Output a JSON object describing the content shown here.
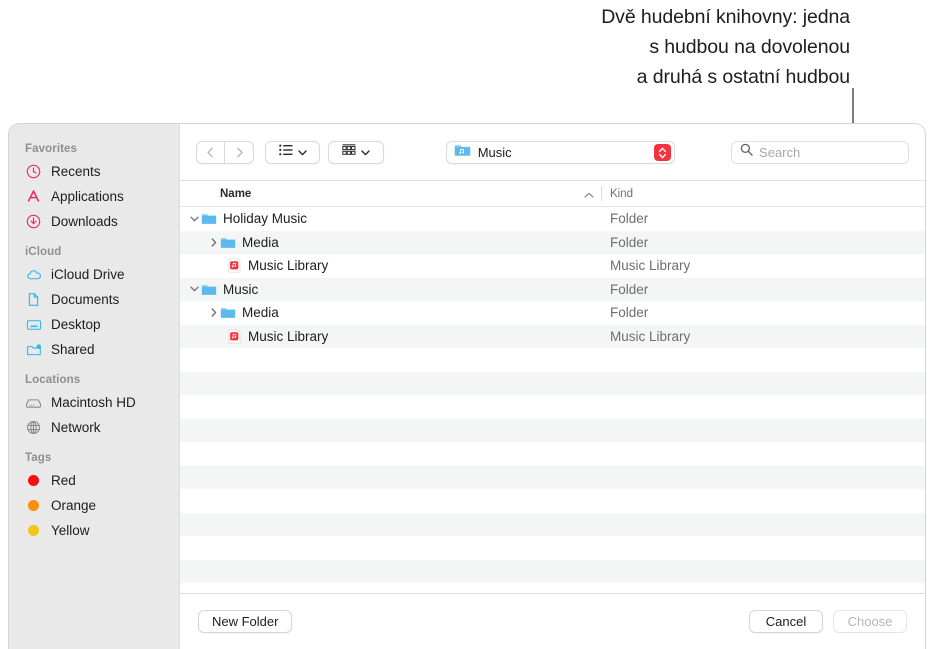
{
  "annotation": {
    "lines": [
      "Dvě hudební knihovny: jedna",
      "s hudbou na dovolenou",
      "a druhá s ostatní hudbou"
    ]
  },
  "sidebar": {
    "groups": [
      {
        "header": "Favorites",
        "items": [
          {
            "label": "Recents",
            "icon": "clock-icon",
            "color": "#f5265c"
          },
          {
            "label": "Applications",
            "icon": "applications-icon",
            "color": "#f5265c"
          },
          {
            "label": "Downloads",
            "icon": "download-circle-icon",
            "color": "#f5265c"
          }
        ]
      },
      {
        "header": "iCloud",
        "items": [
          {
            "label": "iCloud Drive",
            "icon": "cloud-icon",
            "color": "#2cb8e8"
          },
          {
            "label": "Documents",
            "icon": "document-icon",
            "color": "#2cb8e8"
          },
          {
            "label": "Desktop",
            "icon": "desktop-icon",
            "color": "#2cb8e8"
          },
          {
            "label": "Shared",
            "icon": "shared-folder-icon",
            "color": "#2cb8e8"
          }
        ]
      },
      {
        "header": "Locations",
        "items": [
          {
            "label": "Macintosh HD",
            "icon": "harddisk-icon",
            "color": "#8a8a8e"
          },
          {
            "label": "Network",
            "icon": "globe-icon",
            "color": "#8a8a8e"
          }
        ]
      },
      {
        "header": "Tags",
        "items": [
          {
            "label": "Red",
            "icon": "tag-dot-icon",
            "color": "#fb0d0d"
          },
          {
            "label": "Orange",
            "icon": "tag-dot-icon",
            "color": "#f99009"
          },
          {
            "label": "Yellow",
            "icon": "tag-dot-icon",
            "color": "#f5c518"
          }
        ]
      }
    ]
  },
  "toolbar": {
    "back_label": "Back",
    "forward_label": "Forward",
    "view_label": "List view",
    "group_label": "Group by",
    "path": {
      "label": "Music",
      "icon": "music-folder-icon"
    },
    "search": {
      "placeholder": "Search",
      "value": "",
      "icon": "search-icon"
    },
    "stepper_color": "#f5333f"
  },
  "columns": {
    "name": "Name",
    "kind": "Kind",
    "sort_indicator": "ascending"
  },
  "files": [
    {
      "name": "Holiday Music",
      "kind": "Folder",
      "icon": "folder-icon",
      "indent": 0,
      "disclosure": "expanded",
      "alt": false
    },
    {
      "name": "Media",
      "kind": "Folder",
      "icon": "folder-icon",
      "indent": 1,
      "disclosure": "collapsed",
      "alt": true
    },
    {
      "name": "Music Library",
      "kind": "Music Library",
      "icon": "music-library-icon",
      "indent": 2,
      "disclosure": "none",
      "alt": false
    },
    {
      "name": "Music",
      "kind": "Folder",
      "icon": "folder-icon",
      "indent": 0,
      "disclosure": "expanded",
      "alt": true
    },
    {
      "name": "Media",
      "kind": "Folder",
      "icon": "folder-icon",
      "indent": 1,
      "disclosure": "collapsed",
      "alt": false
    },
    {
      "name": "Music Library",
      "kind": "Music Library",
      "icon": "music-library-icon",
      "indent": 2,
      "disclosure": "none",
      "alt": true
    }
  ],
  "empty_rows": 10,
  "buttons": {
    "new_folder": "New Folder",
    "cancel": "Cancel",
    "choose": "Choose",
    "choose_disabled": true
  }
}
